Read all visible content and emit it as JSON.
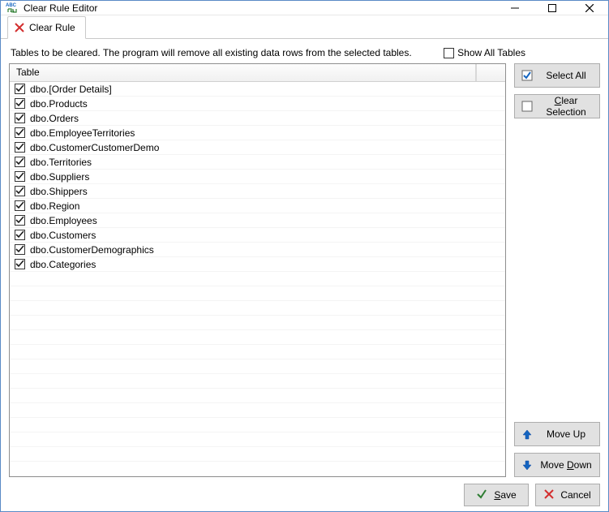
{
  "window": {
    "title": "Clear Rule Editor"
  },
  "tab": {
    "label": "Clear Rule"
  },
  "description": "Tables to be cleared. The program will remove all existing data rows from the selected tables.",
  "show_all": {
    "label": "Show All Tables",
    "checked": false
  },
  "table_header": "Table",
  "tables": [
    {
      "name": "dbo.[Order Details]",
      "checked": true
    },
    {
      "name": "dbo.Products",
      "checked": true
    },
    {
      "name": "dbo.Orders",
      "checked": true
    },
    {
      "name": "dbo.EmployeeTerritories",
      "checked": true
    },
    {
      "name": "dbo.CustomerCustomerDemo",
      "checked": true
    },
    {
      "name": "dbo.Territories",
      "checked": true
    },
    {
      "name": "dbo.Suppliers",
      "checked": true
    },
    {
      "name": "dbo.Shippers",
      "checked": true
    },
    {
      "name": "dbo.Region",
      "checked": true
    },
    {
      "name": "dbo.Employees",
      "checked": true
    },
    {
      "name": "dbo.Customers",
      "checked": true
    },
    {
      "name": "dbo.CustomerDemographics",
      "checked": true
    },
    {
      "name": "dbo.Categories",
      "checked": true
    }
  ],
  "buttons": {
    "select_all": "Select All",
    "clear_selection_pre": "",
    "clear_selection_u": "C",
    "clear_selection_post": "lear Selection",
    "move_up": "Move Up",
    "move_down_pre": "Move ",
    "move_down_u": "D",
    "move_down_post": "own",
    "save_u": "S",
    "save_post": "ave",
    "cancel": "Cancel"
  }
}
